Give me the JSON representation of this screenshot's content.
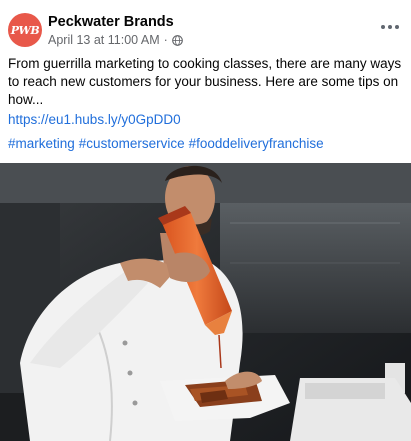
{
  "post": {
    "author": {
      "avatar_initials": "PWB",
      "name": "Peckwater Brands"
    },
    "timestamp": "April 13 at 11:00 AM",
    "separator": "·",
    "audience_icon": "globe-icon",
    "more_icon": "more-options-icon",
    "text": "From guerrilla marketing to cooking classes, there are many ways to reach new customers for your business. Here are some tips on how...",
    "link": "https://eu1.hubs.ly/y0GpDD0",
    "hashtags": [
      "#marketing",
      "#customerservice",
      "#fooddeliveryfranchise"
    ],
    "photo": {
      "subject": "chef-drizzling-sauce-on-food-photo"
    }
  },
  "colors": {
    "avatar_bg": "#e8584a",
    "link": "#216fdb",
    "secondary_text": "#65676b",
    "primary_text": "#050505"
  }
}
